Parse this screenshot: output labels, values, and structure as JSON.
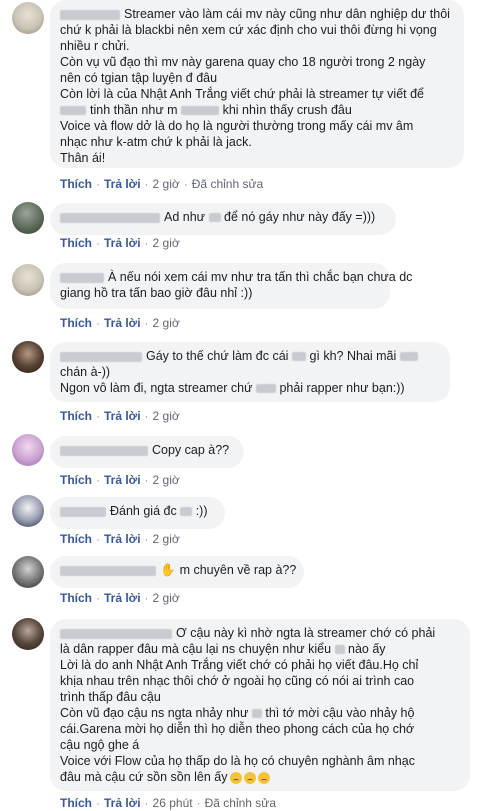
{
  "comments": [
    {
      "lines": [
        "Streamer vào làm cái mv này cũng như dân nghiệp dư thôi",
        "chứ k phải là blackbi nên xem cứ xác định cho vui thôi đừng hi vọng",
        "nhiều r chửi.",
        "Còn vụ vũ đạo thì mv này garena quay cho 18 người trong 2 ngày",
        "nên có tgian tập luyện đ đâu",
        "Còn lời là của Nhật Anh Trắng viết chứ      phải là streamer tự viết để",
        "tinh thần như m",
        "khi nhìn thấy crush đâu",
        "Voice và flow dở là do họ là người thường trong mấy cái mv âm",
        "nhạc như k-atm chứ k phải là jack.",
        "Thân ái!"
      ],
      "actions": {
        "like": "Thích",
        "reply": "Trả lời",
        "time": "2 giờ",
        "edited": "Đã chỉnh sửa"
      }
    },
    {
      "text_a": "Ad như",
      "text_b": "để nó gáy như này đấy =)))",
      "actions": {
        "like": "Thích",
        "reply": "Trả lời",
        "time": "2 giờ"
      }
    },
    {
      "lines": [
        "À nếu nói xem cái mv như tra tấn thì chắc bạn chưa dc",
        "giang hồ tra tấn bao giờ đâu nhỉ :))"
      ],
      "actions": {
        "like": "Thích",
        "reply": "Trả lời",
        "time": "2 giờ"
      }
    },
    {
      "l1a": "Gáy to thế chứ làm đc cái",
      "l1b": "gì kh? Nhai mãi",
      "l2": "chán à-))",
      "l3a": "Ngon vô làm đi, ngta streamer chứ",
      "l3b": "phải rapper như bạn:))",
      "actions": {
        "like": "Thích",
        "reply": "Trả lời",
        "time": "2 giờ"
      }
    },
    {
      "text": "Copy cap à??",
      "actions": {
        "like": "Thích",
        "reply": "Trả lời",
        "time": "2 giờ"
      }
    },
    {
      "text_a": "Đánh giá đc",
      "text_b": ":))",
      "actions": {
        "like": "Thích",
        "reply": "Trả lời",
        "time": "2 giờ"
      }
    },
    {
      "text": "m chuyên về rap à??",
      "actions": {
        "like": "Thích",
        "reply": "Trả lời",
        "time": "2 giờ"
      }
    },
    {
      "l1": "Ơ cậu này kì nhờ ngta là streamer chớ có phải",
      "l2a": "là dân rapper đâu mà cậu lại ns chuyện như kiểu",
      "l2b": "nào ấy",
      "l3": "Lời là do anh Nhật Anh Trắng viết chớ có phải họ viết đâu.Họ chỉ",
      "l4": "khịa nhau trên nhạc thôi chớ ở ngoài họ cũng có nói ai trình cao",
      "l5": "trình thấp đâu cậu",
      "l6a": "Còn vũ đạo cậu ns ngta nhảy như",
      "l6b": "thì tớ mời cậu vào nhảy hộ",
      "l7": "cái.Garena mời họ diễn thì họ diễn theo phong cách của họ chớ",
      "l8": "cậu ngộ ghe á",
      "l9": "Voice với Flow của họ thấp do là họ có chuyên nghành âm nhạc",
      "l10": "đâu mà cậu cứ sồn sồn lên ấy",
      "actions": {
        "like": "Thích",
        "reply": "Trả lời",
        "time": "26 phút",
        "edited": "Đã chỉnh sửa"
      }
    }
  ]
}
